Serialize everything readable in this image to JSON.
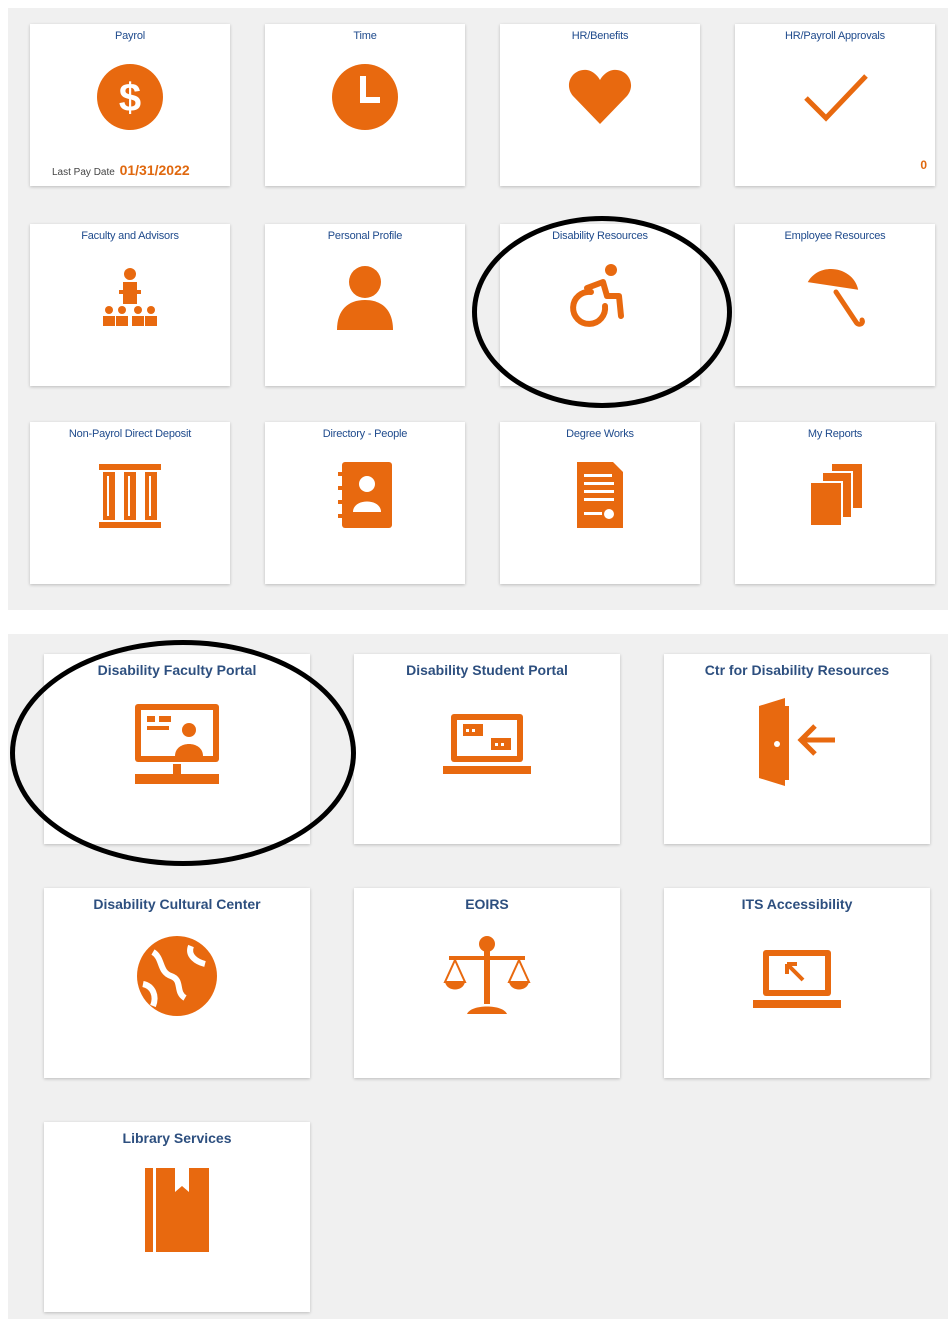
{
  "accent_color": "#e8690f",
  "title_color": "#1e4a8c",
  "top_tiles": [
    {
      "title": "Payrol",
      "icon": "dollar-icon",
      "last_pay_label": "Last Pay Date",
      "last_pay_date": "01/31/2022"
    },
    {
      "title": "Time",
      "icon": "clock-icon"
    },
    {
      "title": "HR/Benefits",
      "icon": "heart-icon"
    },
    {
      "title": "HR/Payroll Approvals",
      "icon": "checkmark-icon",
      "count": "0"
    },
    {
      "title": "Faculty and Advisors",
      "icon": "presenter-icon"
    },
    {
      "title": "Personal Profile",
      "icon": "person-icon"
    },
    {
      "title": "Disability Resources",
      "icon": "wheelchair-icon"
    },
    {
      "title": "Employee Resources",
      "icon": "umbrella-icon"
    },
    {
      "title": "Non-Payrol Direct Deposit",
      "icon": "bank-columns-icon"
    },
    {
      "title": "Directory - People",
      "icon": "address-book-icon"
    },
    {
      "title": "Degree Works",
      "icon": "certificate-document-icon"
    },
    {
      "title": "My Reports",
      "icon": "stacked-pages-icon"
    }
  ],
  "bottom_tiles": [
    {
      "title": "Disability Faculty Portal",
      "icon": "monitor-presentation-icon"
    },
    {
      "title": "Disability Student Portal",
      "icon": "laptop-chat-icon"
    },
    {
      "title": "Ctr for Disability Resources",
      "icon": "door-enter-icon"
    },
    {
      "title": "Disability Cultural Center",
      "icon": "globe-icon"
    },
    {
      "title": "EOIRS",
      "icon": "scales-icon"
    },
    {
      "title": "ITS Accessibility",
      "icon": "laptop-cursor-icon"
    },
    {
      "title": "Library Services",
      "icon": "bookmarked-book-icon"
    }
  ]
}
